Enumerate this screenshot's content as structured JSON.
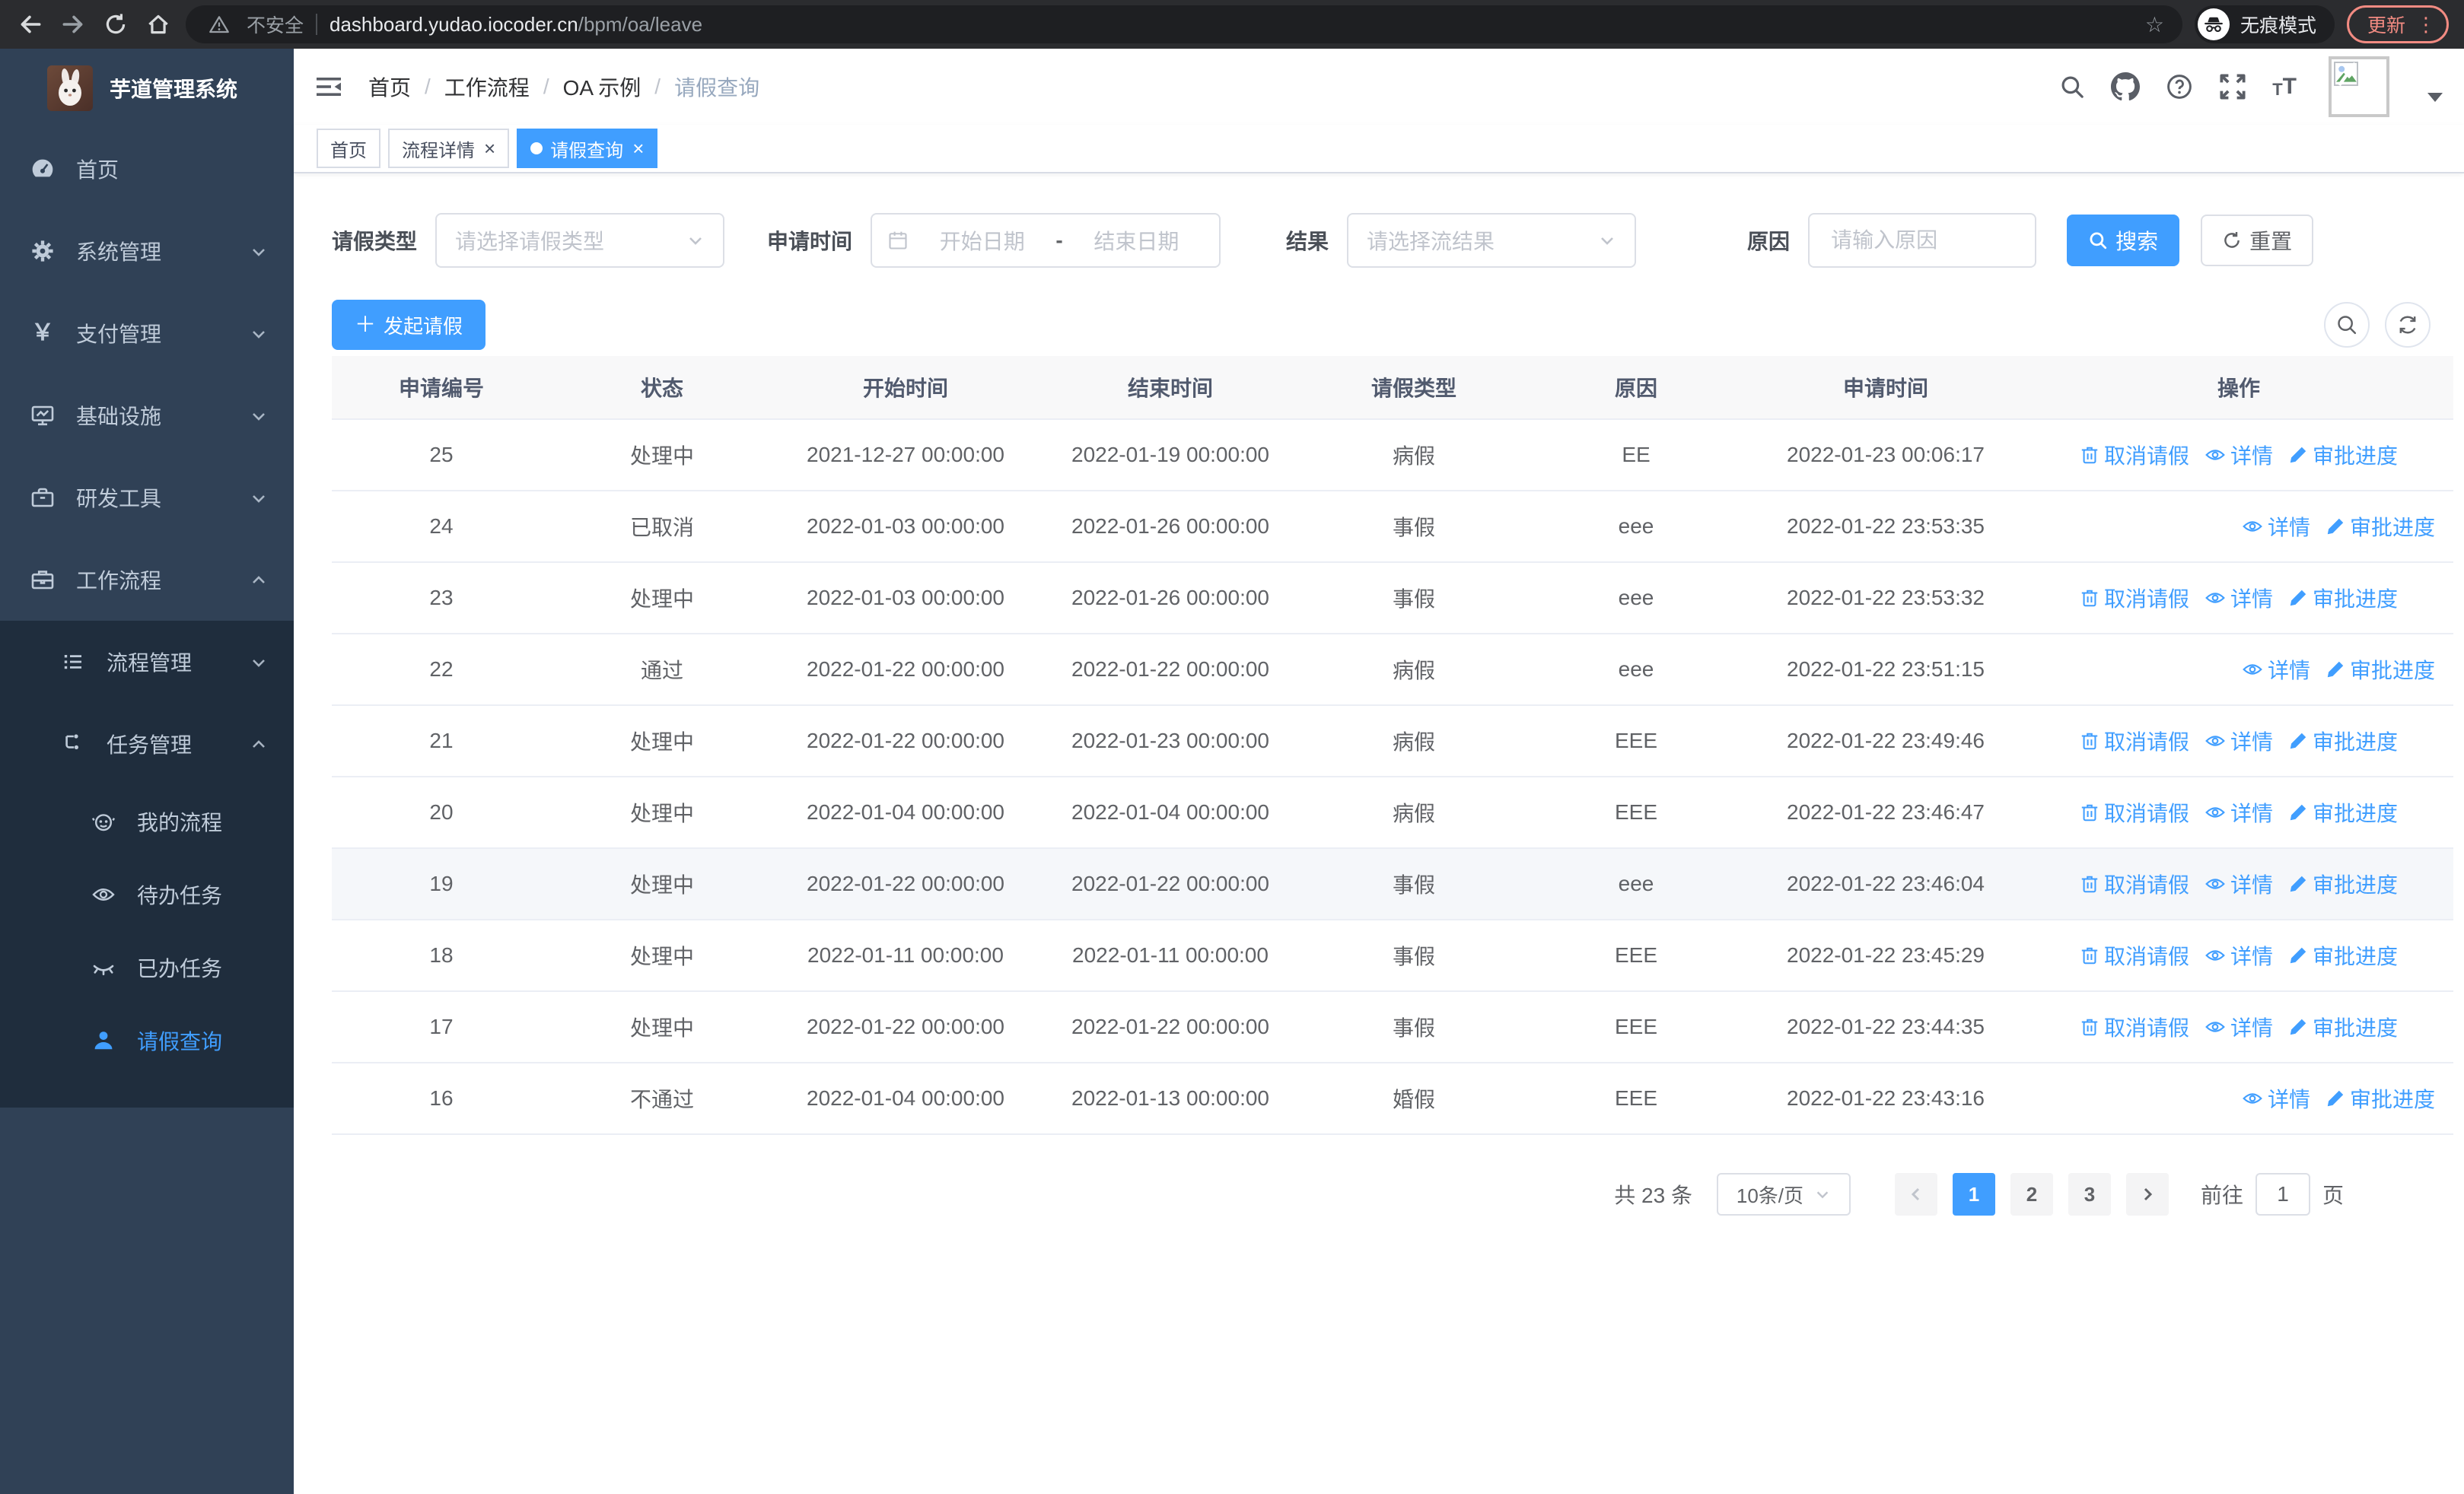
{
  "colors": {
    "accent": "#409eff",
    "sidebar_bg": "#304156",
    "submenu_bg": "#1f2d3d",
    "menu_text": "#bfcbd9",
    "update_pill": "#f28b82"
  },
  "browser": {
    "security_warning": "不安全",
    "url_host": "dashboard.yudao.iocoder.cn",
    "url_path": "/bpm/oa/leave",
    "incognito_label": "无痕模式",
    "update_label": "更新"
  },
  "sidebar": {
    "title": "芋道管理系统",
    "items": [
      {
        "label": "首页"
      },
      {
        "label": "系统管理"
      },
      {
        "label": "支付管理"
      },
      {
        "label": "基础设施"
      },
      {
        "label": "研发工具"
      },
      {
        "label": "工作流程"
      },
      {
        "label": "流程管理"
      },
      {
        "label": "任务管理"
      },
      {
        "label": "我的流程"
      },
      {
        "label": "待办任务"
      },
      {
        "label": "已办任务"
      },
      {
        "label": "请假查询"
      }
    ],
    "yen_glyph": "￥"
  },
  "navbar": {
    "breadcrumb": [
      "首页",
      "工作流程",
      "OA 示例",
      "请假查询"
    ],
    "separator": "/"
  },
  "tags": [
    {
      "label": "首页"
    },
    {
      "label": "流程详情"
    },
    {
      "label": "请假查询"
    }
  ],
  "filters": {
    "leave_type_label": "请假类型",
    "leave_type_placeholder": "请选择请假类型",
    "apply_time_label": "申请时间",
    "date_start_placeholder": "开始日期",
    "date_separator": "-",
    "date_end_placeholder": "结束日期",
    "result_label": "结果",
    "result_placeholder": "请选择流结果",
    "reason_label": "原因",
    "reason_placeholder": "请输入原因",
    "search_label": "搜索",
    "reset_label": "重置"
  },
  "toolbar": {
    "create_label": "发起请假"
  },
  "table": {
    "headers": [
      "申请编号",
      "状态",
      "开始时间",
      "结束时间",
      "请假类型",
      "原因",
      "申请时间",
      "操作"
    ],
    "action_labels": {
      "cancel": "取消请假",
      "detail": "详情",
      "progress": "审批进度"
    },
    "rows": [
      {
        "id": "25",
        "status": "处理中",
        "start": "2021-12-27 00:00:00",
        "end": "2022-01-19 00:00:00",
        "type": "病假",
        "reason": "EE",
        "applied": "2022-01-23 00:06:17"
      },
      {
        "id": "24",
        "status": "已取消",
        "start": "2022-01-03 00:00:00",
        "end": "2022-01-26 00:00:00",
        "type": "事假",
        "reason": "eee",
        "applied": "2022-01-22 23:53:35"
      },
      {
        "id": "23",
        "status": "处理中",
        "start": "2022-01-03 00:00:00",
        "end": "2022-01-26 00:00:00",
        "type": "事假",
        "reason": "eee",
        "applied": "2022-01-22 23:53:32"
      },
      {
        "id": "22",
        "status": "通过",
        "start": "2022-01-22 00:00:00",
        "end": "2022-01-22 00:00:00",
        "type": "病假",
        "reason": "eee",
        "applied": "2022-01-22 23:51:15"
      },
      {
        "id": "21",
        "status": "处理中",
        "start": "2022-01-22 00:00:00",
        "end": "2022-01-23 00:00:00",
        "type": "病假",
        "reason": "EEE",
        "applied": "2022-01-22 23:49:46"
      },
      {
        "id": "20",
        "status": "处理中",
        "start": "2022-01-04 00:00:00",
        "end": "2022-01-04 00:00:00",
        "type": "病假",
        "reason": "EEE",
        "applied": "2022-01-22 23:46:47"
      },
      {
        "id": "19",
        "status": "处理中",
        "start": "2022-01-22 00:00:00",
        "end": "2022-01-22 00:00:00",
        "type": "事假",
        "reason": "eee",
        "applied": "2022-01-22 23:46:04"
      },
      {
        "id": "18",
        "status": "处理中",
        "start": "2022-01-11 00:00:00",
        "end": "2022-01-11 00:00:00",
        "type": "事假",
        "reason": "EEE",
        "applied": "2022-01-22 23:45:29"
      },
      {
        "id": "17",
        "status": "处理中",
        "start": "2022-01-22 00:00:00",
        "end": "2022-01-22 00:00:00",
        "type": "事假",
        "reason": "EEE",
        "applied": "2022-01-22 23:44:35"
      },
      {
        "id": "16",
        "status": "不通过",
        "start": "2022-01-04 00:00:00",
        "end": "2022-01-13 00:00:00",
        "type": "婚假",
        "reason": "EEE",
        "applied": "2022-01-22 23:43:16"
      }
    ]
  },
  "pagination": {
    "total": "共 23 条",
    "page_size": "10条/页",
    "pages": [
      "1",
      "2",
      "3"
    ],
    "active_page": "1",
    "goto_label": "前往",
    "goto_value": "1",
    "unit_label": "页"
  }
}
